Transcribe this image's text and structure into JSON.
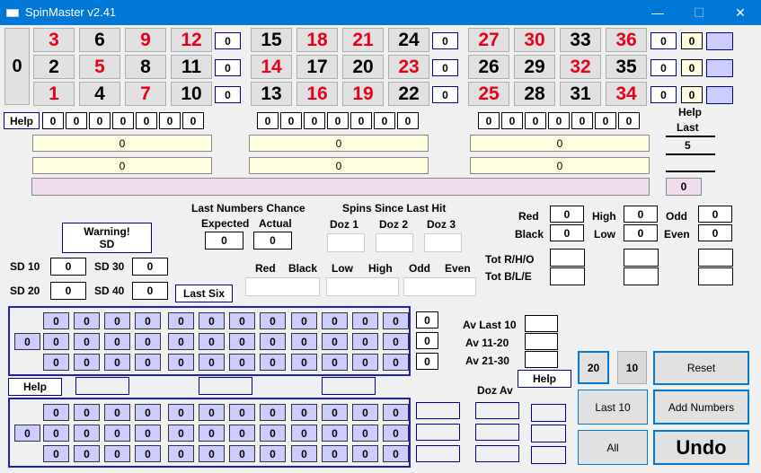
{
  "window": {
    "title": "SpinMaster v2.41",
    "minimize": "—",
    "maximize": "☐",
    "close": "✕"
  },
  "zero": "0",
  "board": {
    "rows": [
      [
        {
          "n": "3",
          "c": "r"
        },
        {
          "n": "6",
          "c": "b"
        },
        {
          "n": "9",
          "c": "r"
        },
        {
          "n": "12",
          "c": "r"
        },
        {
          "n": "15",
          "c": "b"
        },
        {
          "n": "18",
          "c": "r"
        },
        {
          "n": "21",
          "c": "r"
        },
        {
          "n": "24",
          "c": "b"
        },
        {
          "n": "27",
          "c": "r"
        },
        {
          "n": "30",
          "c": "r"
        },
        {
          "n": "33",
          "c": "b"
        },
        {
          "n": "36",
          "c": "r"
        }
      ],
      [
        {
          "n": "2",
          "c": "b"
        },
        {
          "n": "5",
          "c": "r"
        },
        {
          "n": "8",
          "c": "b"
        },
        {
          "n": "11",
          "c": "b"
        },
        {
          "n": "14",
          "c": "r"
        },
        {
          "n": "17",
          "c": "b"
        },
        {
          "n": "20",
          "c": "b"
        },
        {
          "n": "23",
          "c": "r"
        },
        {
          "n": "26",
          "c": "b"
        },
        {
          "n": "29",
          "c": "b"
        },
        {
          "n": "32",
          "c": "r"
        },
        {
          "n": "35",
          "c": "b"
        }
      ],
      [
        {
          "n": "1",
          "c": "r"
        },
        {
          "n": "4",
          "c": "b"
        },
        {
          "n": "7",
          "c": "r"
        },
        {
          "n": "10",
          "c": "b"
        },
        {
          "n": "13",
          "c": "b"
        },
        {
          "n": "16",
          "c": "r"
        },
        {
          "n": "19",
          "c": "r"
        },
        {
          "n": "22",
          "c": "b"
        },
        {
          "n": "25",
          "c": "r"
        },
        {
          "n": "28",
          "c": "b"
        },
        {
          "n": "31",
          "c": "b"
        },
        {
          "n": "34",
          "c": "r"
        }
      ]
    ],
    "group_counts": [
      [
        "0",
        "0",
        "0"
      ],
      [
        "0",
        "0",
        "0"
      ],
      [
        "0",
        "0",
        "0"
      ]
    ],
    "column_counts": [
      "0",
      "0",
      "0"
    ],
    "column_yellow": [
      "0",
      "0",
      "0"
    ]
  },
  "help_label": "Help",
  "dozen_counters": [
    [
      "0",
      "0",
      "0",
      "0",
      "0",
      "0",
      "0"
    ],
    [
      "0",
      "0",
      "0",
      "0",
      "0",
      "0",
      "0"
    ],
    [
      "0",
      "0",
      "0",
      "0",
      "0",
      "0",
      "0"
    ]
  ],
  "yellow_bars": [
    [
      "0",
      "0",
      "0"
    ],
    [
      "0",
      "0",
      "0"
    ]
  ],
  "help_last": {
    "label1": "Help",
    "label2": "Last",
    "value": "5"
  },
  "bottom_bar_value": "0",
  "last_numbers": {
    "title": "Last Numbers Chance",
    "expected_label": "Expected",
    "actual_label": "Actual",
    "expected": "0",
    "actual": "0"
  },
  "spins_since": {
    "title": "Spins Since Last Hit",
    "labels": [
      "Doz 1",
      "Doz 2",
      "Doz 3"
    ]
  },
  "warning": {
    "line1": "Warning!",
    "line2": "SD"
  },
  "sd": {
    "sd10_label": "SD 10",
    "sd10": "0",
    "sd30_label": "SD 30",
    "sd30": "0",
    "sd20_label": "SD 20",
    "sd20": "0",
    "sd40_label": "SD 40",
    "sd40": "0"
  },
  "last_six_label": "Last Six",
  "rhlo_labels": [
    "Red",
    "Black",
    "Low",
    "High",
    "Odd",
    "Even"
  ],
  "stats": {
    "red_label": "Red",
    "red": "0",
    "black_label": "Black",
    "black": "0",
    "high_label": "High",
    "high": "0",
    "low_label": "Low",
    "low": "0",
    "odd_label": "Odd",
    "odd": "0",
    "even_label": "Even",
    "even": "0"
  },
  "tot": {
    "rho": "Tot R/H/O",
    "ble": "Tot B/L/E"
  },
  "grid1": {
    "left": "0",
    "rows": [
      [
        "0",
        "0",
        "0",
        "0",
        "0",
        "0",
        "0",
        "0",
        "0",
        "0",
        "0",
        "0"
      ],
      [
        "0",
        "0",
        "0",
        "0",
        "0",
        "0",
        "0",
        "0",
        "0",
        "0",
        "0",
        "0"
      ],
      [
        "0",
        "0",
        "0",
        "0",
        "0",
        "0",
        "0",
        "0",
        "0",
        "0",
        "0",
        "0"
      ]
    ],
    "right": [
      "0",
      "0",
      "0"
    ]
  },
  "grid2": {
    "left": "0",
    "rows": [
      [
        "0",
        "0",
        "0",
        "0",
        "0",
        "0",
        "0",
        "0",
        "0",
        "0",
        "0",
        "0"
      ],
      [
        "0",
        "0",
        "0",
        "0",
        "0",
        "0",
        "0",
        "0",
        "0",
        "0",
        "0",
        "0"
      ],
      [
        "0",
        "0",
        "0",
        "0",
        "0",
        "0",
        "0",
        "0",
        "0",
        "0",
        "0",
        "0"
      ]
    ]
  },
  "averages": {
    "last10": "Av Last 10",
    "a1120": "Av 11-20",
    "a2130": "Av 21-30"
  },
  "doz_av_label": "Doz Av",
  "buttons": {
    "b20": "20",
    "b10": "10",
    "reset": "Reset",
    "last10": "Last 10",
    "add": "Add Numbers",
    "all": "All",
    "undo": "Undo"
  }
}
